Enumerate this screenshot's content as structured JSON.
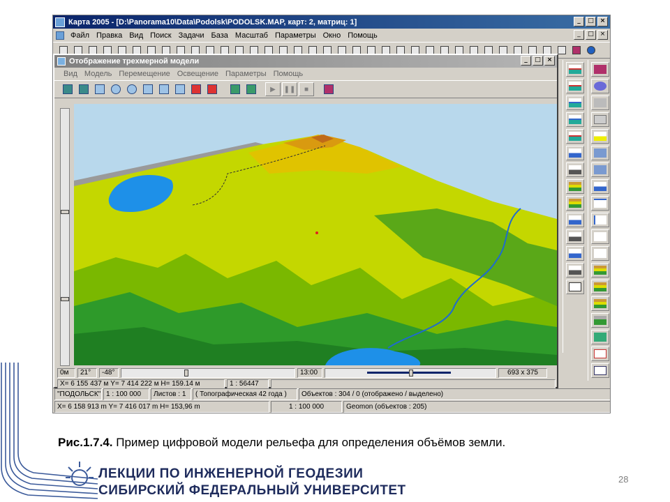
{
  "app": {
    "title": "Карта 2005 - [D:\\Panorama10\\Data\\Podolsk\\PODOLSK.MAP, карт: 2, матриц: 1]",
    "window_buttons": [
      "_",
      "□",
      "×"
    ],
    "menu": [
      "Файл",
      "Правка",
      "Вид",
      "Поиск",
      "Задачи",
      "База",
      "Масштаб",
      "Параметры",
      "Окно",
      "Помощь"
    ]
  },
  "child": {
    "title": "Отображение трехмерной модели",
    "menu": [
      "Вид",
      "Модель",
      "Перемещение",
      "Освещение",
      "Параметры",
      "Помощь"
    ],
    "play_buttons": [
      "▶",
      "❚❚",
      "■"
    ]
  },
  "view_bar": {
    "height": "0м",
    "angle1": "21°",
    "angle2": "-48°",
    "time": "13:00",
    "size": "693 x 375"
  },
  "child_status": {
    "coords": "X= 6 155 437 м Y= 7 414 222 м  H= 159.14 м",
    "scale": "1 : 56447"
  },
  "status1": {
    "name": "\"ПОДОЛЬСК\"",
    "scale": "1 : 100 000",
    "sheets": "Листов : 1",
    "proj": "( Топографическая 42 года )",
    "objects": "Объектов : 304 / 0 (отображено / выделено)"
  },
  "status2": {
    "coords": "X=   6 158 913 m  Y=   7 416 017 m  H= 153,96 m",
    "scale": "1 : 100 000",
    "geomon": "Geomon  (объектов : 205)"
  },
  "caption": {
    "label": "Рис.1.7.4.",
    "text": " Пример цифровой модели рельефа для определения объёмов земли."
  },
  "page_number": "28",
  "footer": {
    "line1": "ЛЕКЦИИ ПО ИНЖЕНЕРНОЙ ГЕОДЕЗИИ",
    "line2": "СИБИРСКИЙ ФЕДЕРАЛЬНЫЙ УНИВЕРСИТЕТ"
  },
  "colors": {
    "sky": "#b8d8ec",
    "water": "#1e90e8",
    "peak": "#c97a1a",
    "yellow": "#d8dc00",
    "green": "#2e9a2a",
    "footer_text": "#1e2b5c"
  }
}
